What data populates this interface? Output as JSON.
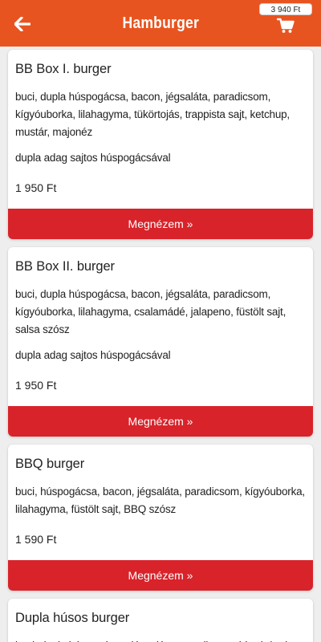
{
  "header": {
    "title": "Hamburger",
    "cart_total": "3 940 Ft"
  },
  "colors": {
    "header": "#e8541f",
    "button": "#d8232a",
    "background": "#eeeeee"
  },
  "products": [
    {
      "name": "BB Box I. burger",
      "description": "buci, dupla húspogácsa, bacon, jégsaláta, paradicsom, kígyóuborka, lilahagyma, tükörtojás, trappista sajt, ketchup, mustár, majonéz",
      "note": "dupla adag sajtos húspogácsával",
      "price": "1 950 Ft",
      "button": "Megnézem »"
    },
    {
      "name": "BB Box II. burger",
      "description": "buci, dupla húspogácsa, bacon, jégsaláta, paradicsom, kígyóuborka, lilahagyma, csalamádé, jalapeno, füstölt sajt, salsa szósz",
      "note": "dupla adag sajtos húspogácsával",
      "price": "1 950 Ft",
      "button": "Megnézem »"
    },
    {
      "name": "BBQ burger",
      "description": "buci, húspogácsa, bacon, jégsaláta, paradicsom, kígyóuborka, lilahagyma, füstölt sajt, BBQ szósz",
      "price": "1 590 Ft",
      "button": "Megnézem »"
    },
    {
      "name": "Dupla húsos burger",
      "description": "buci, dupla húspogácsa, jégsaláta, paradicsom, kígyóuborka"
    }
  ]
}
